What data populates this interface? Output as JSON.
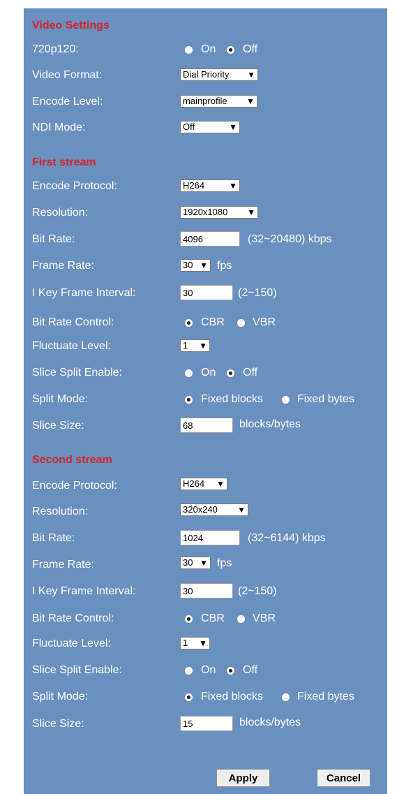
{
  "video_settings": {
    "title": "Video Settings",
    "p720p120": {
      "label": "720p120:",
      "on": "On",
      "off": "Off",
      "selected": "off"
    },
    "video_format": {
      "label": "Video Format:",
      "value": "Dial Priority"
    },
    "encode_level": {
      "label": "Encode Level:",
      "value": "mainprofile"
    },
    "ndi_mode": {
      "label": "NDI Mode:",
      "value": "Off"
    }
  },
  "first_stream": {
    "title": "First stream",
    "encode_protocol": {
      "label": "Encode Protocol:",
      "value": "H264"
    },
    "resolution": {
      "label": "Resolution:",
      "value": "1920x1080"
    },
    "bit_rate": {
      "label": "Bit Rate:",
      "value": "4096",
      "range": "(32~20480) kbps"
    },
    "frame_rate": {
      "label": "Frame Rate:",
      "value": "30",
      "unit": "fps"
    },
    "i_key_frame_interval": {
      "label": "I Key Frame Interval:",
      "value": "30",
      "range": "(2~150)"
    },
    "bit_rate_control": {
      "label": "Bit Rate Control:",
      "cbr": "CBR",
      "vbr": "VBR",
      "selected": "cbr"
    },
    "fluctuate_level": {
      "label": "Fluctuate Level:",
      "value": "1"
    },
    "slice_split_enable": {
      "label": "Slice Split Enable:",
      "on": "On",
      "off": "Off",
      "selected": "off"
    },
    "split_mode": {
      "label": "Split Mode:",
      "fixed_blocks": "Fixed blocks",
      "fixed_bytes": "Fixed bytes",
      "selected": "fixed_blocks"
    },
    "slice_size": {
      "label": "Slice Size:",
      "value": "68",
      "unit": "blocks/bytes"
    }
  },
  "second_stream": {
    "title": "Second stream",
    "encode_protocol": {
      "label": "Encode Protocol:",
      "value": "H264"
    },
    "resolution": {
      "label": "Resolution:",
      "value": "320x240"
    },
    "bit_rate": {
      "label": "Bit Rate:",
      "value": "1024",
      "range": "(32~6144) kbps"
    },
    "frame_rate": {
      "label": "Frame Rate:",
      "value": "30",
      "unit": "fps"
    },
    "i_key_frame_interval": {
      "label": "I Key Frame Interval:",
      "value": "30",
      "range": "(2~150)"
    },
    "bit_rate_control": {
      "label": "Bit Rate Control:",
      "cbr": "CBR",
      "vbr": "VBR",
      "selected": "cbr"
    },
    "fluctuate_level": {
      "label": "Fluctuate Level:",
      "value": "1"
    },
    "slice_split_enable": {
      "label": "Slice Split Enable:",
      "on": "On",
      "off": "Off",
      "selected": "off"
    },
    "split_mode": {
      "label": "Split Mode:",
      "fixed_blocks": "Fixed blocks",
      "fixed_bytes": "Fixed bytes",
      "selected": "fixed_blocks"
    },
    "slice_size": {
      "label": "Slice Size:",
      "value": "15",
      "unit": "blocks/bytes"
    }
  },
  "buttons": {
    "apply": "Apply",
    "cancel": "Cancel"
  },
  "colors": {
    "panel_bg": "#6a90bf",
    "section_title": "#d8242b",
    "label": "#ffffff"
  }
}
